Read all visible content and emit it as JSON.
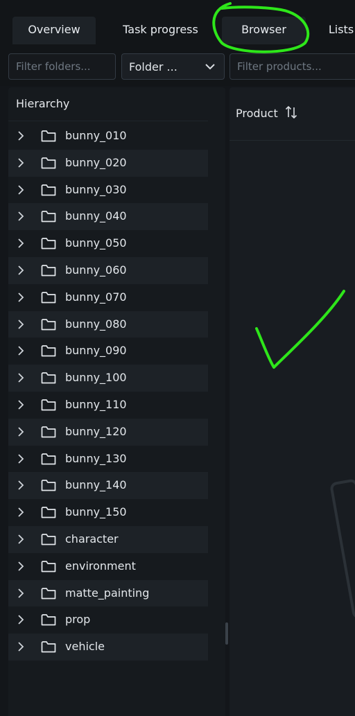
{
  "tabs": [
    {
      "label": "Overview",
      "active": true
    },
    {
      "label": "Task progress",
      "active": false
    },
    {
      "label": "Browser",
      "active": true
    },
    {
      "label": "Lists",
      "active": false
    }
  ],
  "filters": {
    "folders_placeholder": "Filter folders...",
    "folder_select_value": "Folder ...",
    "products_placeholder": "Filter products..."
  },
  "hierarchy": {
    "title": "Hierarchy",
    "items": [
      "bunny_010",
      "bunny_020",
      "bunny_030",
      "bunny_040",
      "bunny_050",
      "bunny_060",
      "bunny_070",
      "bunny_080",
      "bunny_090",
      "bunny_100",
      "bunny_110",
      "bunny_120",
      "bunny_130",
      "bunny_140",
      "bunny_150",
      "character",
      "environment",
      "matte_painting",
      "prop",
      "vehicle"
    ]
  },
  "products": {
    "column_label": "Product"
  },
  "icons": {
    "row_expand": "chevron-right-icon",
    "row_folder": "folder-icon",
    "select_arrow": "chevron-down-icon",
    "sort": "sort-icon"
  },
  "colors": {
    "annotation": "#2ee61a",
    "background": "#13161a",
    "row_alt": "#1d2227",
    "tab_active": "#1d2227"
  }
}
